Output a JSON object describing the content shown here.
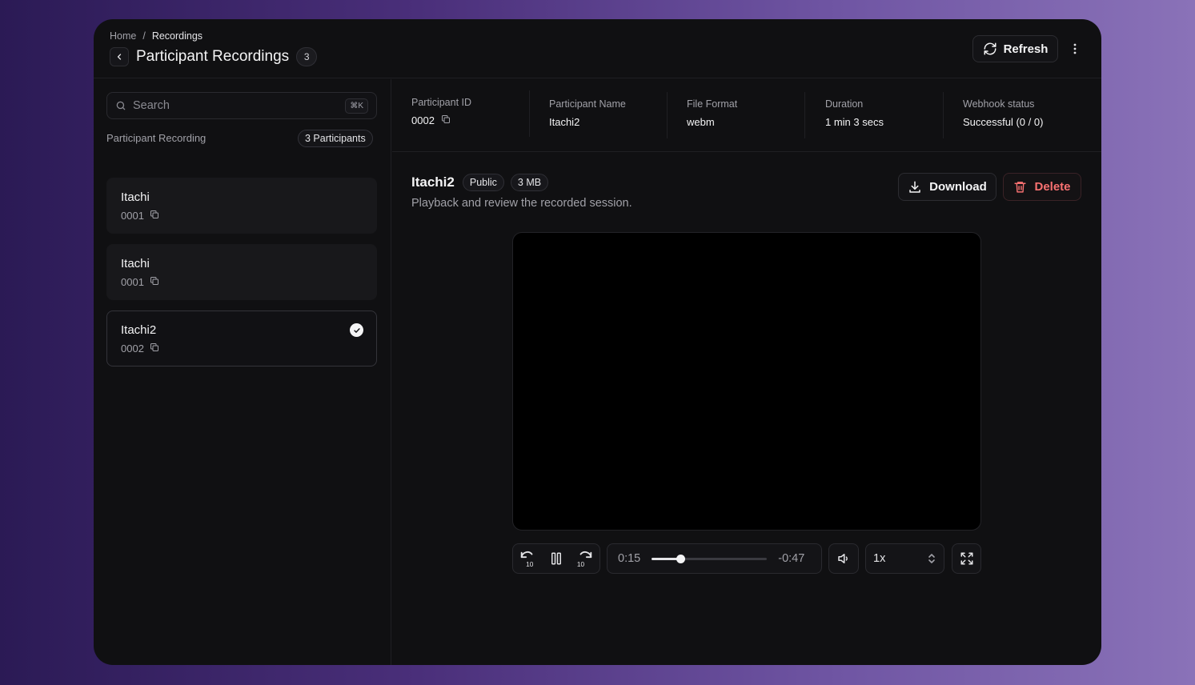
{
  "breadcrumb": {
    "home": "Home",
    "separator": "/",
    "current": "Recordings"
  },
  "page": {
    "title": "Participant Recordings",
    "count": "3"
  },
  "actions": {
    "refresh_label": "Refresh"
  },
  "sidebar": {
    "search_placeholder": "Search",
    "search_shortcut": "⌘K",
    "section_label": "Participant Recording",
    "participants_badge": "3 Participants",
    "items": [
      {
        "name": "Itachi",
        "id": "0001",
        "selected": false
      },
      {
        "name": "Itachi",
        "id": "0001",
        "selected": false
      },
      {
        "name": "Itachi2",
        "id": "0002",
        "selected": true
      }
    ]
  },
  "details": {
    "participant_id_label": "Participant ID",
    "participant_id": "0002",
    "participant_name_label": "Participant Name",
    "participant_name": "Itachi2",
    "file_format_label": "File Format",
    "file_format": "webm",
    "duration_label": "Duration",
    "duration": "1 min 3 secs",
    "webhook_label": "Webhook status",
    "webhook_status": "Successful (0 / 0)"
  },
  "recording": {
    "title": "Itachi2",
    "visibility": "Public",
    "size": "3 MB",
    "subtitle": "Playback and review the recorded session.",
    "download_label": "Download",
    "delete_label": "Delete"
  },
  "player": {
    "current_time": "0:15",
    "remaining_time": "-0:47",
    "progress": 0.25,
    "speed": "1x",
    "skip_seconds": "10"
  },
  "colors": {
    "danger": "#f87171",
    "background": "#101012"
  }
}
